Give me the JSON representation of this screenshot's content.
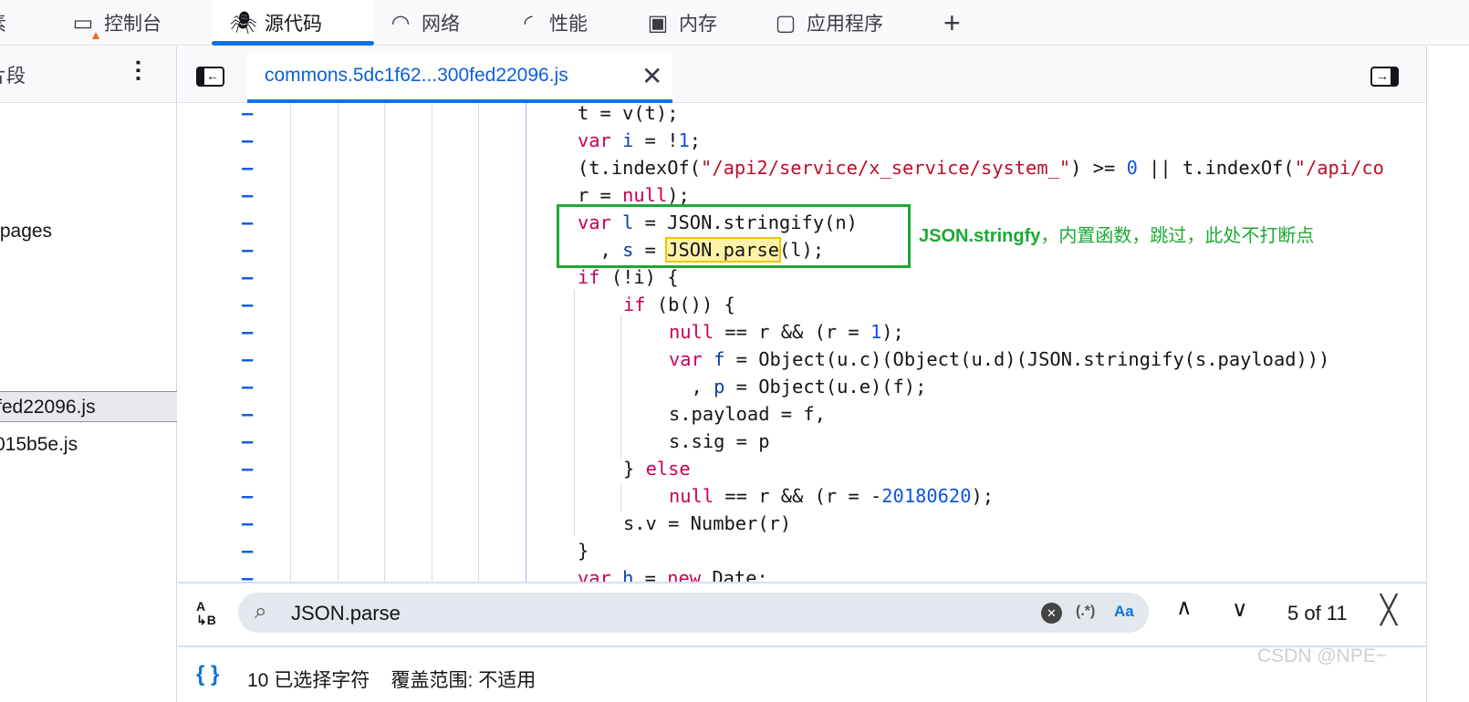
{
  "toolbar_tabs": [
    {
      "label": "素",
      "icon": "inspector-icon"
    },
    {
      "label": "控制台",
      "icon": "console-icon",
      "warning": true
    },
    {
      "label": "源代码",
      "icon": "debugger-bug-icon",
      "active": true
    },
    {
      "label": "网络",
      "icon": "network-wifi-icon"
    },
    {
      "label": "性能",
      "icon": "performance-gauge-icon"
    },
    {
      "label": "内存",
      "icon": "memory-chip-icon"
    },
    {
      "label": "应用程序",
      "icon": "application-icon"
    },
    {
      "label": "+",
      "icon": "plus-icon"
    }
  ],
  "sidebar": {
    "header": "片段",
    "items": [
      {
        "label": "/pages"
      },
      {
        "label": "fed22096.js",
        "selected": true
      },
      {
        "label": "015b5e.js"
      }
    ]
  },
  "editor": {
    "tab_label": "commons.5dc1f62...300fed22096.js",
    "lines": [
      {
        "indent": 0,
        "tokens": [
          [
            "t = v(t);",
            ""
          ]
        ]
      },
      {
        "indent": 0,
        "tokens": [
          [
            "var",
            "kw"
          ],
          [
            " ",
            ""
          ],
          [
            "i",
            "def"
          ],
          [
            " = !",
            ""
          ],
          [
            "1",
            "num"
          ],
          [
            ";",
            ""
          ]
        ]
      },
      {
        "indent": 0,
        "tokens": [
          [
            "(t.indexOf(",
            ""
          ],
          [
            "\"/api2/service/x_service/system_\"",
            "str"
          ],
          [
            ") >= ",
            ""
          ],
          [
            "0",
            "num"
          ],
          [
            " || t.indexOf(",
            ""
          ],
          [
            "\"/api/co",
            "str"
          ]
        ]
      },
      {
        "indent": 0,
        "tokens": [
          [
            "r = ",
            ""
          ],
          [
            "null",
            "kw"
          ],
          [
            ");",
            ""
          ]
        ]
      },
      {
        "indent": 0,
        "tokens": [
          [
            "var",
            "kw"
          ],
          [
            " ",
            ""
          ],
          [
            "l",
            "def"
          ],
          [
            " = JSON.stringify(n)",
            ""
          ]
        ]
      },
      {
        "indent": 0,
        "tokens": [
          [
            "  , ",
            ""
          ],
          [
            "s",
            "def"
          ],
          [
            " = ",
            ""
          ],
          [
            "JSON.parse",
            "match"
          ],
          [
            "(l);",
            ""
          ]
        ]
      },
      {
        "indent": 0,
        "tokens": [
          [
            "if",
            "kw"
          ],
          [
            " (!i) {",
            ""
          ]
        ]
      },
      {
        "indent": 1,
        "tokens": [
          [
            "if",
            "kw"
          ],
          [
            " (b()) {",
            ""
          ]
        ]
      },
      {
        "indent": 2,
        "tokens": [
          [
            "null",
            "kw"
          ],
          [
            " == r && (r = ",
            ""
          ],
          [
            "1",
            "num"
          ],
          [
            ");",
            ""
          ]
        ]
      },
      {
        "indent": 2,
        "tokens": [
          [
            "var",
            "kw"
          ],
          [
            " ",
            ""
          ],
          [
            "f",
            "def"
          ],
          [
            " = Object(u.c)(Object(u.d)(JSON.stringify(s.payload)))",
            ""
          ]
        ]
      },
      {
        "indent": 2,
        "tokens": [
          [
            "  , ",
            ""
          ],
          [
            "p",
            "def"
          ],
          [
            " = Object(u.e)(f);",
            ""
          ]
        ]
      },
      {
        "indent": 2,
        "tokens": [
          [
            "s.payload = f,",
            ""
          ]
        ]
      },
      {
        "indent": 2,
        "tokens": [
          [
            "s.sig = p",
            ""
          ]
        ]
      },
      {
        "indent": 1,
        "tokens": [
          [
            "} ",
            ""
          ],
          [
            "else",
            "kw"
          ]
        ]
      },
      {
        "indent": 2,
        "tokens": [
          [
            "null",
            "kw"
          ],
          [
            " == r && (r = -",
            ""
          ],
          [
            "20180620",
            "num"
          ],
          [
            ");",
            ""
          ]
        ]
      },
      {
        "indent": 1,
        "tokens": [
          [
            "s.v = Number(r)",
            ""
          ]
        ]
      },
      {
        "indent": 0,
        "tokens": [
          [
            "}",
            ""
          ]
        ]
      },
      {
        "indent": 0,
        "tokens": [
          [
            "var",
            "kw"
          ],
          [
            " ",
            ""
          ],
          [
            "h",
            "def"
          ],
          [
            " = ",
            ""
          ],
          [
            "new",
            "kw"
          ],
          [
            " Date;",
            ""
          ]
        ]
      }
    ],
    "annotation": {
      "bold": "JSON.stringfy",
      "rest": "，内置函数，跳过，此处不打断点",
      "color": "#1aaa33"
    }
  },
  "find": {
    "query": "JSON.parse",
    "regex_label": "(.*)",
    "case_label": "Aa",
    "match_count": "5 of 11"
  },
  "status": {
    "text": "10 已选择字符    覆盖范围: 不适用"
  },
  "watermark": "CSDN @NPE~",
  "colors": {
    "accent": "#0b74de",
    "keyword": "#c8005a",
    "string": "#b8102b",
    "number": "#1054d9",
    "match": "#fff3a8",
    "annotation_box": "#1aaa33"
  }
}
